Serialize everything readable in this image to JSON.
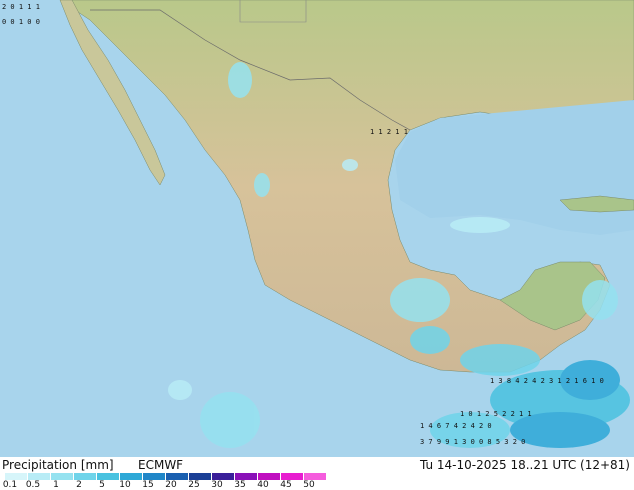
{
  "footer": {
    "left_label": "Precipitation [mm]",
    "model": "ECMWF",
    "valid_time": "Tu 14-10-2025 18..21 UTC (12+81)"
  },
  "legend": {
    "ticks": [
      "0.1",
      "0.5",
      "1",
      "2",
      "5",
      "10",
      "15",
      "20",
      "25",
      "30",
      "35",
      "40",
      "45",
      "50"
    ],
    "colors": [
      "#d6f5fa",
      "#b8ecf6",
      "#95e2f0",
      "#6fd4ea",
      "#49c2e0",
      "#2da8d7",
      "#1f86c8",
      "#1a5fb0",
      "#1b3f96",
      "#3a1f9a",
      "#8a11b8",
      "#c00fc0",
      "#e81dd0",
      "#f55cdd"
    ]
  },
  "map_labels": [
    {
      "id": "r1",
      "text": "2 0 1 1 1"
    },
    {
      "id": "r2",
      "text": "0 0 1 0 0"
    },
    {
      "id": "r3",
      "text": "1 1 2 1 1"
    },
    {
      "id": "r4",
      "text": "1 0 1 2 5 2 2 1 1"
    },
    {
      "id": "r5",
      "text": "1 4 6 7 4 2 4 2 0"
    },
    {
      "id": "r6",
      "text": "3 7 9 9 1 3 0 0 8 5 3 2 0"
    },
    {
      "id": "r7",
      "text": "1 3 8 4 2 4 2 3 1 2 1 6 1 0"
    }
  ]
}
